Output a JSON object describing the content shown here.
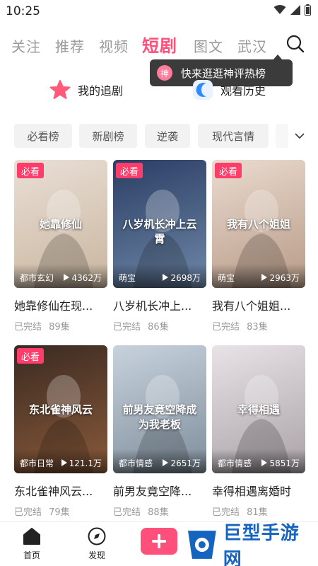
{
  "status_bar": {
    "time": "10:25"
  },
  "top_tabs": [
    {
      "label": "关注",
      "active": false
    },
    {
      "label": "推荐",
      "active": false
    },
    {
      "label": "视频",
      "active": false
    },
    {
      "label": "短剧",
      "active": true
    },
    {
      "label": "图文",
      "active": false
    },
    {
      "label": "武汉",
      "active": false
    }
  ],
  "tooltip": {
    "badge": "神",
    "text": "快来逛逛神评热榜"
  },
  "quick_entries": [
    {
      "label": "我的追剧",
      "icon": "star-icon",
      "color": "#ff5a7a"
    },
    {
      "label": "观看历史",
      "icon": "history-icon",
      "color": "#2f8cff"
    }
  ],
  "chips": [
    "必看榜",
    "新剧榜",
    "逆袭",
    "现代言情"
  ],
  "cards": [
    {
      "badge": "必看",
      "genre": "都市玄幻",
      "views": "4362万",
      "title": "她靠修仙在现...",
      "status": "已完结",
      "episodes": "89集",
      "poster_text": "她靠修仙",
      "bg1": "#e9dfd6",
      "bg2": "#c9b59e"
    },
    {
      "badge": "必看",
      "genre": "萌宝",
      "views": "2698万",
      "title": "八岁机长冲上...",
      "status": "已完结",
      "episodes": "86集",
      "poster_text": "八岁机长冲上云霄",
      "bg1": "#2a3e63",
      "bg2": "#6e87a8"
    },
    {
      "badge": "必看",
      "genre": "萌宝",
      "views": "2963万",
      "title": "我有八个姐姐...",
      "status": "已完结",
      "episodes": "83集",
      "poster_text": "我有八个姐姐",
      "bg1": "#eadbd0",
      "bg2": "#b79a86"
    },
    {
      "badge": "必看",
      "genre": "都市日常",
      "views": "121.1万",
      "title": "东北雀神风云...",
      "status": "已完结",
      "episodes": "79集",
      "poster_text": "东北雀神风云",
      "bg1": "#3a2a22",
      "bg2": "#8a5a3a"
    },
    {
      "badge": "",
      "genre": "都市情感",
      "views": "2651万",
      "title": "前男友竟空降...",
      "status": "已完结",
      "episodes": "88集",
      "poster_text": "前男友竟空降成为我老板",
      "bg1": "#c7d2dc",
      "bg2": "#7f8e9c"
    },
    {
      "badge": "",
      "genre": "都市情感",
      "views": "5851万",
      "title": "幸得相遇离婚时",
      "status": "已完结",
      "episodes": "81集",
      "poster_text": "幸得相遇",
      "bg1": "#e8e3e6",
      "bg2": "#a9a1a6"
    }
  ],
  "bottom_nav": [
    {
      "label": "首页",
      "icon": "home-icon"
    },
    {
      "label": "发现",
      "icon": "compass-icon"
    }
  ],
  "watermark": {
    "text": "巨型手游网"
  },
  "colors": {
    "accent": "#ff4f7b",
    "badge": "#ff3d6a"
  }
}
